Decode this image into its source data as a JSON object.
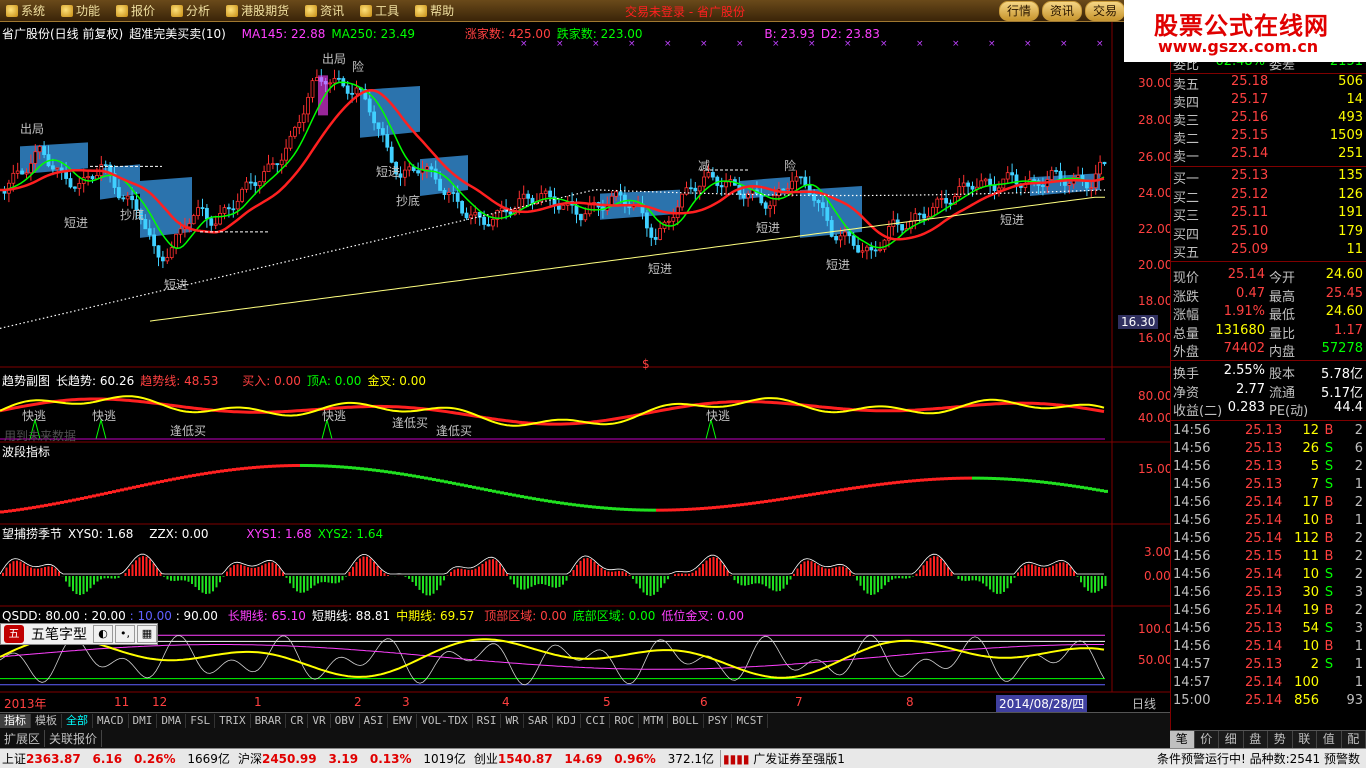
{
  "menu": {
    "items": [
      {
        "label": "系统"
      },
      {
        "label": "功能"
      },
      {
        "label": "报价"
      },
      {
        "label": "分析"
      },
      {
        "label": "港股期货"
      },
      {
        "label": "资讯"
      },
      {
        "label": "工具"
      },
      {
        "label": "帮助"
      }
    ],
    "center_title": "交易未登录 - 省广股份",
    "right_buttons": [
      {
        "label": "行情"
      },
      {
        "label": "资讯"
      },
      {
        "label": "交易"
      }
    ]
  },
  "watermark": {
    "title": "股票公式在线网",
    "url": "www.gszx.com.cn"
  },
  "main_chart": {
    "header_name": "省广股份(日线 前复权)",
    "header_formula": "超准完美买卖(10)",
    "ma145": "MA145: 22.88",
    "ma250": "MA250: 23.49",
    "up_count": "涨家数: 425.00",
    "down_count": "跌家数: 223.00",
    "b_val": "B: 23.93",
    "d2_val": "D2: 23.83",
    "y_ticks": [
      "30.00",
      "28.00",
      "26.00",
      "24.00",
      "22.00",
      "20.00",
      "18.00",
      "16.00"
    ],
    "current_price_tag": "16.30",
    "annotations": {
      "chuju1": "出局",
      "chuju2": "出局",
      "xian1": "险",
      "xian2": "险",
      "duanjin": "短进",
      "chaodi": "抄底",
      "jian": "减",
      "dollar": "$"
    }
  },
  "chart_data": {
    "type": "candlestick",
    "y_range": [
      16,
      31.5
    ],
    "series": [
      {
        "name": "MA145"
      },
      {
        "name": "MA250"
      }
    ]
  },
  "sub1": {
    "title": "趋势副图",
    "long_trend": "长趋势: 60.26",
    "trend_line": "趋势线: 48.53",
    "buy": "买入: 0.00",
    "top_a": "顶A: 0.00",
    "golden": "金叉: 0.00",
    "y_ticks": [
      "80.00",
      "40.00"
    ],
    "kuaitao": "快逃",
    "fengdimai": "逢低买",
    "future_data": "用到未来数据"
  },
  "sub2": {
    "title": "波段指标",
    "y_ticks": [
      "15.00"
    ]
  },
  "sub3": {
    "title": "望捕捞季节",
    "xys0": "XYS0: 1.68",
    "zzx": "ZZX: 0.00",
    "xys1": "XYS1: 1.68",
    "xys2": "XYS2: 1.64",
    "y_ticks": [
      "3.00",
      "0.00"
    ]
  },
  "sub4": {
    "title": "QSDD",
    "l80": ": 80.00",
    "l20": ": 20.00",
    "l10": ": 10.00",
    "l90": ": 90.00",
    "long_line": "长期线: 65.10",
    "short_line": "短期线: 88.81",
    "mid_line": "中期线: 69.57",
    "top_zone": "顶部区域: 0.00",
    "bottom_zone": "底部区域: 0.00",
    "low_golden": "低位金叉: 0.00",
    "y_ticks": [
      "100.0",
      "50.00"
    ]
  },
  "x_axis": {
    "months": [
      "2013年",
      "11",
      "12",
      "1",
      "2",
      "3",
      "4",
      "5",
      "6",
      "7",
      "8"
    ],
    "date_tag": "2014/08/28/四",
    "period": "日线"
  },
  "ime": {
    "name": "五笔字型"
  },
  "quote": {
    "top_row": {
      "l1": "委比",
      "v1": "-62.48%",
      "l2": "委差",
      "v2": "-2151"
    },
    "asks": [
      {
        "label": "卖五",
        "price": "25.18",
        "vol": "506"
      },
      {
        "label": "卖四",
        "price": "25.17",
        "vol": "14"
      },
      {
        "label": "卖三",
        "price": "25.16",
        "vol": "493"
      },
      {
        "label": "卖二",
        "price": "25.15",
        "vol": "1509"
      },
      {
        "label": "卖一",
        "price": "25.14",
        "vol": "251"
      }
    ],
    "bids": [
      {
        "label": "买一",
        "price": "25.13",
        "vol": "135"
      },
      {
        "label": "买二",
        "price": "25.12",
        "vol": "126"
      },
      {
        "label": "买三",
        "price": "25.11",
        "vol": "191"
      },
      {
        "label": "买四",
        "price": "25.10",
        "vol": "179"
      },
      {
        "label": "买五",
        "price": "25.09",
        "vol": "11"
      }
    ],
    "stats": [
      {
        "l1": "现价",
        "v1": "25.14",
        "c1": "red",
        "l2": "今开",
        "v2": "24.60",
        "c2": "yellow"
      },
      {
        "l1": "涨跌",
        "v1": "0.47",
        "c1": "red",
        "l2": "最高",
        "v2": "25.45",
        "c2": "red"
      },
      {
        "l1": "涨幅",
        "v1": "1.91%",
        "c1": "red",
        "l2": "最低",
        "v2": "24.60",
        "c2": "yellow"
      },
      {
        "l1": "总量",
        "v1": "131680",
        "c1": "yellow",
        "l2": "量比",
        "v2": "1.17",
        "c2": "red"
      },
      {
        "l1": "外盘",
        "v1": "74402",
        "c1": "red",
        "l2": "内盘",
        "v2": "57278",
        "c2": "green"
      }
    ],
    "stats2": [
      {
        "l1": "换手",
        "v1": "2.55%",
        "c1": "white",
        "l2": "股本",
        "v2": "5.78亿",
        "c2": "white"
      },
      {
        "l1": "净资",
        "v1": "2.77",
        "c1": "white",
        "l2": "流通",
        "v2": "5.17亿",
        "c2": "white"
      },
      {
        "l1": "收益(二)",
        "v1": "0.283",
        "c1": "white",
        "l2": "PE(动)",
        "v2": "44.4",
        "c2": "white"
      }
    ],
    "ticks": [
      {
        "time": "14:56",
        "price": "25.13",
        "pc": "red",
        "vol": "12",
        "bs": "B",
        "bc": "red",
        "n": "2"
      },
      {
        "time": "14:56",
        "price": "25.13",
        "pc": "red",
        "vol": "26",
        "bs": "S",
        "bc": "green",
        "n": "6"
      },
      {
        "time": "14:56",
        "price": "25.13",
        "pc": "red",
        "vol": "5",
        "bs": "S",
        "bc": "green",
        "n": "2"
      },
      {
        "time": "14:56",
        "price": "25.13",
        "pc": "red",
        "vol": "7",
        "bs": "S",
        "bc": "green",
        "n": "1"
      },
      {
        "time": "14:56",
        "price": "25.14",
        "pc": "red",
        "vol": "17",
        "bs": "B",
        "bc": "red",
        "n": "2"
      },
      {
        "time": "14:56",
        "price": "25.14",
        "pc": "red",
        "vol": "10",
        "bs": "B",
        "bc": "red",
        "n": "1"
      },
      {
        "time": "14:56",
        "price": "25.14",
        "pc": "red",
        "vol": "112",
        "bs": "B",
        "bc": "red",
        "n": "2"
      },
      {
        "time": "14:56",
        "price": "25.15",
        "pc": "red",
        "vol": "11",
        "bs": "B",
        "bc": "red",
        "n": "2"
      },
      {
        "time": "14:56",
        "price": "25.14",
        "pc": "red",
        "vol": "10",
        "bs": "S",
        "bc": "green",
        "n": "2"
      },
      {
        "time": "14:56",
        "price": "25.13",
        "pc": "red",
        "vol": "30",
        "bs": "S",
        "bc": "green",
        "n": "3"
      },
      {
        "time": "14:56",
        "price": "25.14",
        "pc": "red",
        "vol": "19",
        "bs": "B",
        "bc": "red",
        "n": "2"
      },
      {
        "time": "14:56",
        "price": "25.13",
        "pc": "red",
        "vol": "54",
        "bs": "S",
        "bc": "green",
        "n": "3"
      },
      {
        "time": "14:56",
        "price": "25.14",
        "pc": "red",
        "vol": "10",
        "bs": "B",
        "bc": "red",
        "n": "1"
      },
      {
        "time": "14:57",
        "price": "25.13",
        "pc": "red",
        "vol": "2",
        "bs": "S",
        "bc": "green",
        "n": "1"
      },
      {
        "time": "14:57",
        "price": "25.14",
        "pc": "red",
        "vol": "100",
        "bs": "",
        "bc": "white",
        "n": "1"
      },
      {
        "time": "15:00",
        "price": "25.14",
        "pc": "red",
        "vol": "856",
        "bs": "",
        "bc": "white",
        "n": "93"
      }
    ]
  },
  "right_tabs": [
    {
      "label": "笔"
    },
    {
      "label": "价"
    },
    {
      "label": "细"
    },
    {
      "label": "盘"
    },
    {
      "label": "势"
    },
    {
      "label": "联"
    },
    {
      "label": "值"
    },
    {
      "label": "配"
    }
  ],
  "indicator_tabs": [
    {
      "label": "指标"
    },
    {
      "label": "模板"
    },
    {
      "label": "全部"
    },
    {
      "label": "MACD"
    },
    {
      "label": "DMI"
    },
    {
      "label": "DMA"
    },
    {
      "label": "FSL"
    },
    {
      "label": "TRIX"
    },
    {
      "label": "BRAR"
    },
    {
      "label": "CR"
    },
    {
      "label": "VR"
    },
    {
      "label": "OBV"
    },
    {
      "label": "ASI"
    },
    {
      "label": "EMV"
    },
    {
      "label": "VOL-TDX"
    },
    {
      "label": "RSI"
    },
    {
      "label": "WR"
    },
    {
      "label": "SAR"
    },
    {
      "label": "KDJ"
    },
    {
      "label": "CCI"
    },
    {
      "label": "ROC"
    },
    {
      "label": "MTM"
    },
    {
      "label": "BOLL"
    },
    {
      "label": "PSY"
    },
    {
      "label": "MCST"
    }
  ],
  "ext_tabs": [
    {
      "label": "扩展区"
    },
    {
      "label": "关联报价"
    }
  ],
  "status": {
    "sh_label": "上证",
    "sh_val": "2363.87",
    "sh_chg": "6.16",
    "sh_pct": "0.26%",
    "sh_amt": "1669亿",
    "sz_label": "沪深",
    "sz_val": "2450.99",
    "sz_chg": "3.19",
    "sz_pct": "0.13%",
    "sz_amt": "1019亿",
    "cy_label": "创业",
    "cy_val": "1540.87",
    "cy_chg": "14.69",
    "cy_pct": "0.96%",
    "cy_amt": "372.1亿",
    "server": "广发证券至强版1",
    "warn": "条件预警运行中! 品种数:2541 预警数"
  }
}
